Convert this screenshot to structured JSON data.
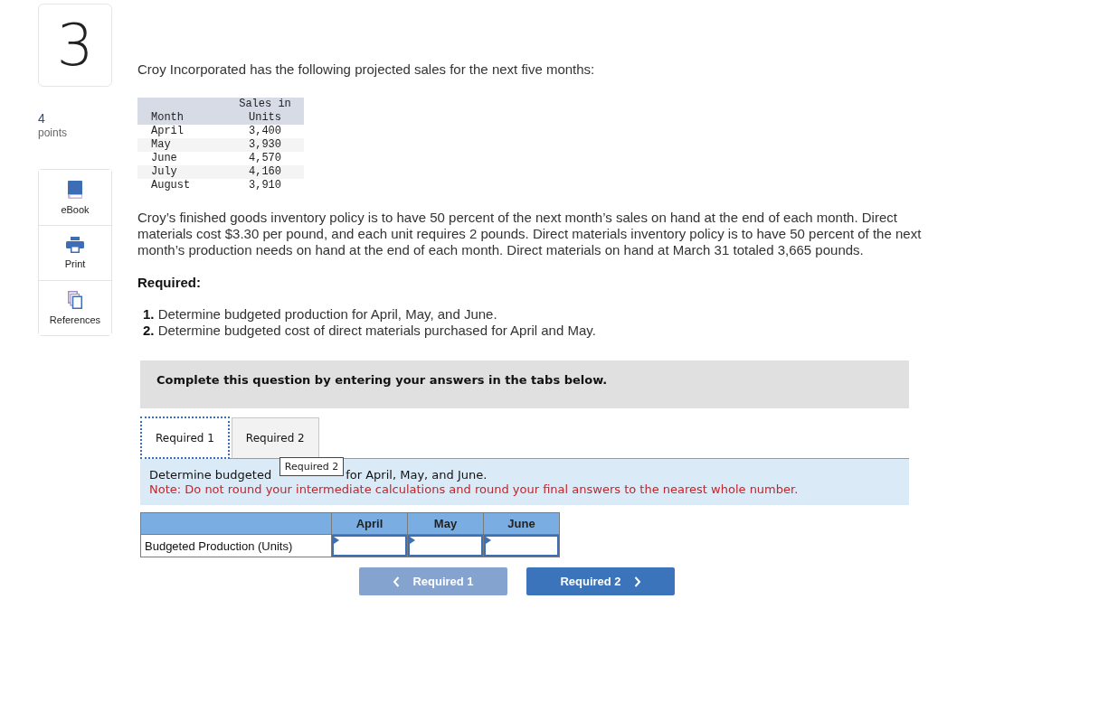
{
  "question": {
    "number": "3",
    "points_value": "4",
    "points_label": "points"
  },
  "tools": [
    {
      "kind": "ebook",
      "label": "eBook"
    },
    {
      "kind": "print",
      "label": "Print"
    },
    {
      "kind": "references",
      "label": "References"
    }
  ],
  "intro": "Croy Incorporated has the following projected sales for the next five months:",
  "sales_table": {
    "columns": [
      "Month",
      "Sales in Units"
    ],
    "rows": [
      [
        "April",
        "3,400"
      ],
      [
        "May",
        "3,930"
      ],
      [
        "June",
        "4,570"
      ],
      [
        "July",
        "4,160"
      ],
      [
        "August",
        "3,910"
      ]
    ]
  },
  "paragraph": "Croy’s finished goods inventory policy is to have 50 percent of the next month’s sales on hand at the end of each month. Direct materials cost $3.30 per pound, and each unit requires 2 pounds. Direct materials inventory policy is to have 50 percent of the next month’s production needs on hand at the end of each month. Direct materials on hand at March 31 totaled 3,665 pounds.",
  "required_heading": "Required:",
  "requirements": [
    "**1.** Determine budgeted production for April, May, and June.",
    "**2.** Determine budgeted cost of direct materials purchased for April and May."
  ],
  "banner": "Complete this question by entering your answers in the tabs below.",
  "tabs": [
    {
      "label": "Required 1",
      "selected": true
    },
    {
      "label": "Required 2",
      "selected": false
    }
  ],
  "instruction": {
    "text_before": "Determine budgeted",
    "text_after": "for April, May, and June.",
    "note": "Note: Do not round your intermediate calculations and round your final answers to the nearest whole number."
  },
  "tooltip": "Required 2",
  "answer_table": {
    "columns": [
      "April",
      "May",
      "June"
    ],
    "rows": [
      {
        "label": "Budgeted Production (Units)"
      }
    ]
  },
  "nav_buttons": [
    {
      "kind": "prev",
      "label": "Required 1",
      "disabled": true
    },
    {
      "kind": "next",
      "label": "Required 2",
      "disabled": false
    }
  ]
}
